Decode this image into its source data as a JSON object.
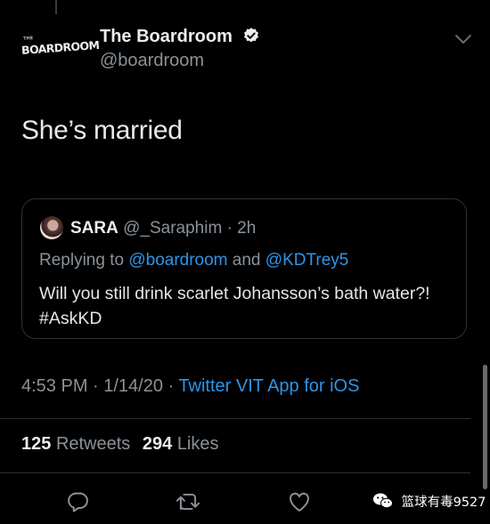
{
  "tweet": {
    "author_logo_text": "BOARDROOM",
    "author_logo_small": "THE",
    "author_name": "The Boardroom",
    "author_handle": "@boardroom",
    "text": "She’s married",
    "timestamp": "4:53 PM · 1/14/20 · ",
    "source": "Twitter VIT App for iOS",
    "retweets": "125",
    "retweets_label": "Retweets",
    "likes": "294",
    "likes_label": "Likes"
  },
  "quoted": {
    "name": "SARA",
    "handle_time": "@_Saraphim · 2h",
    "replying_prefix": "Replying to",
    "reply_user_1": "@boardroom",
    "reply_and": "and",
    "reply_user_2": "@KDTrey5",
    "text_main": "Will you still drink scarlet Johansson’s bath water?! ",
    "hashtag": "#AskKD"
  },
  "watermark": {
    "text": "篮球有毒9527"
  },
  "icons": {
    "verified": "verified-badge-icon",
    "caret": "chevron-down-icon",
    "reply": "reply-icon",
    "retweet": "retweet-icon",
    "like": "heart-icon",
    "watermark": "wechat-icon"
  },
  "colors": {
    "background": "#000000",
    "link": "#2e95e8",
    "muted": "#8b9298"
  }
}
